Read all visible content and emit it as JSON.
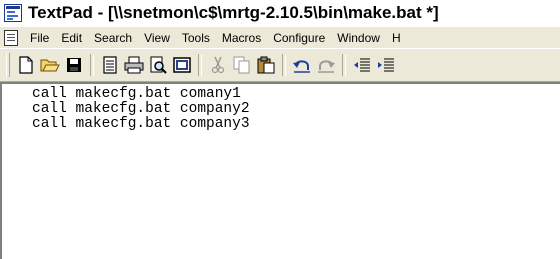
{
  "window": {
    "title": "TextPad - [\\\\snetmon\\c$\\mrtg-2.10.5\\bin\\make.bat *]"
  },
  "menu": {
    "items": [
      "File",
      "Edit",
      "Search",
      "View",
      "Tools",
      "Macros",
      "Configure",
      "Window",
      "H"
    ]
  },
  "toolbar": {
    "buttons": [
      "new-file-icon",
      "open-folder-icon",
      "save-icon",
      "document-properties-icon",
      "print-icon",
      "print-preview-icon",
      "manage-files-icon",
      "cut-icon",
      "copy-icon",
      "paste-icon",
      "undo-icon",
      "redo-icon",
      "outdent-icon",
      "indent-icon"
    ]
  },
  "editor": {
    "lines": [
      "call makecfg.bat comany1",
      "call makecfg.bat company2",
      "call makecfg.bat company3"
    ]
  }
}
